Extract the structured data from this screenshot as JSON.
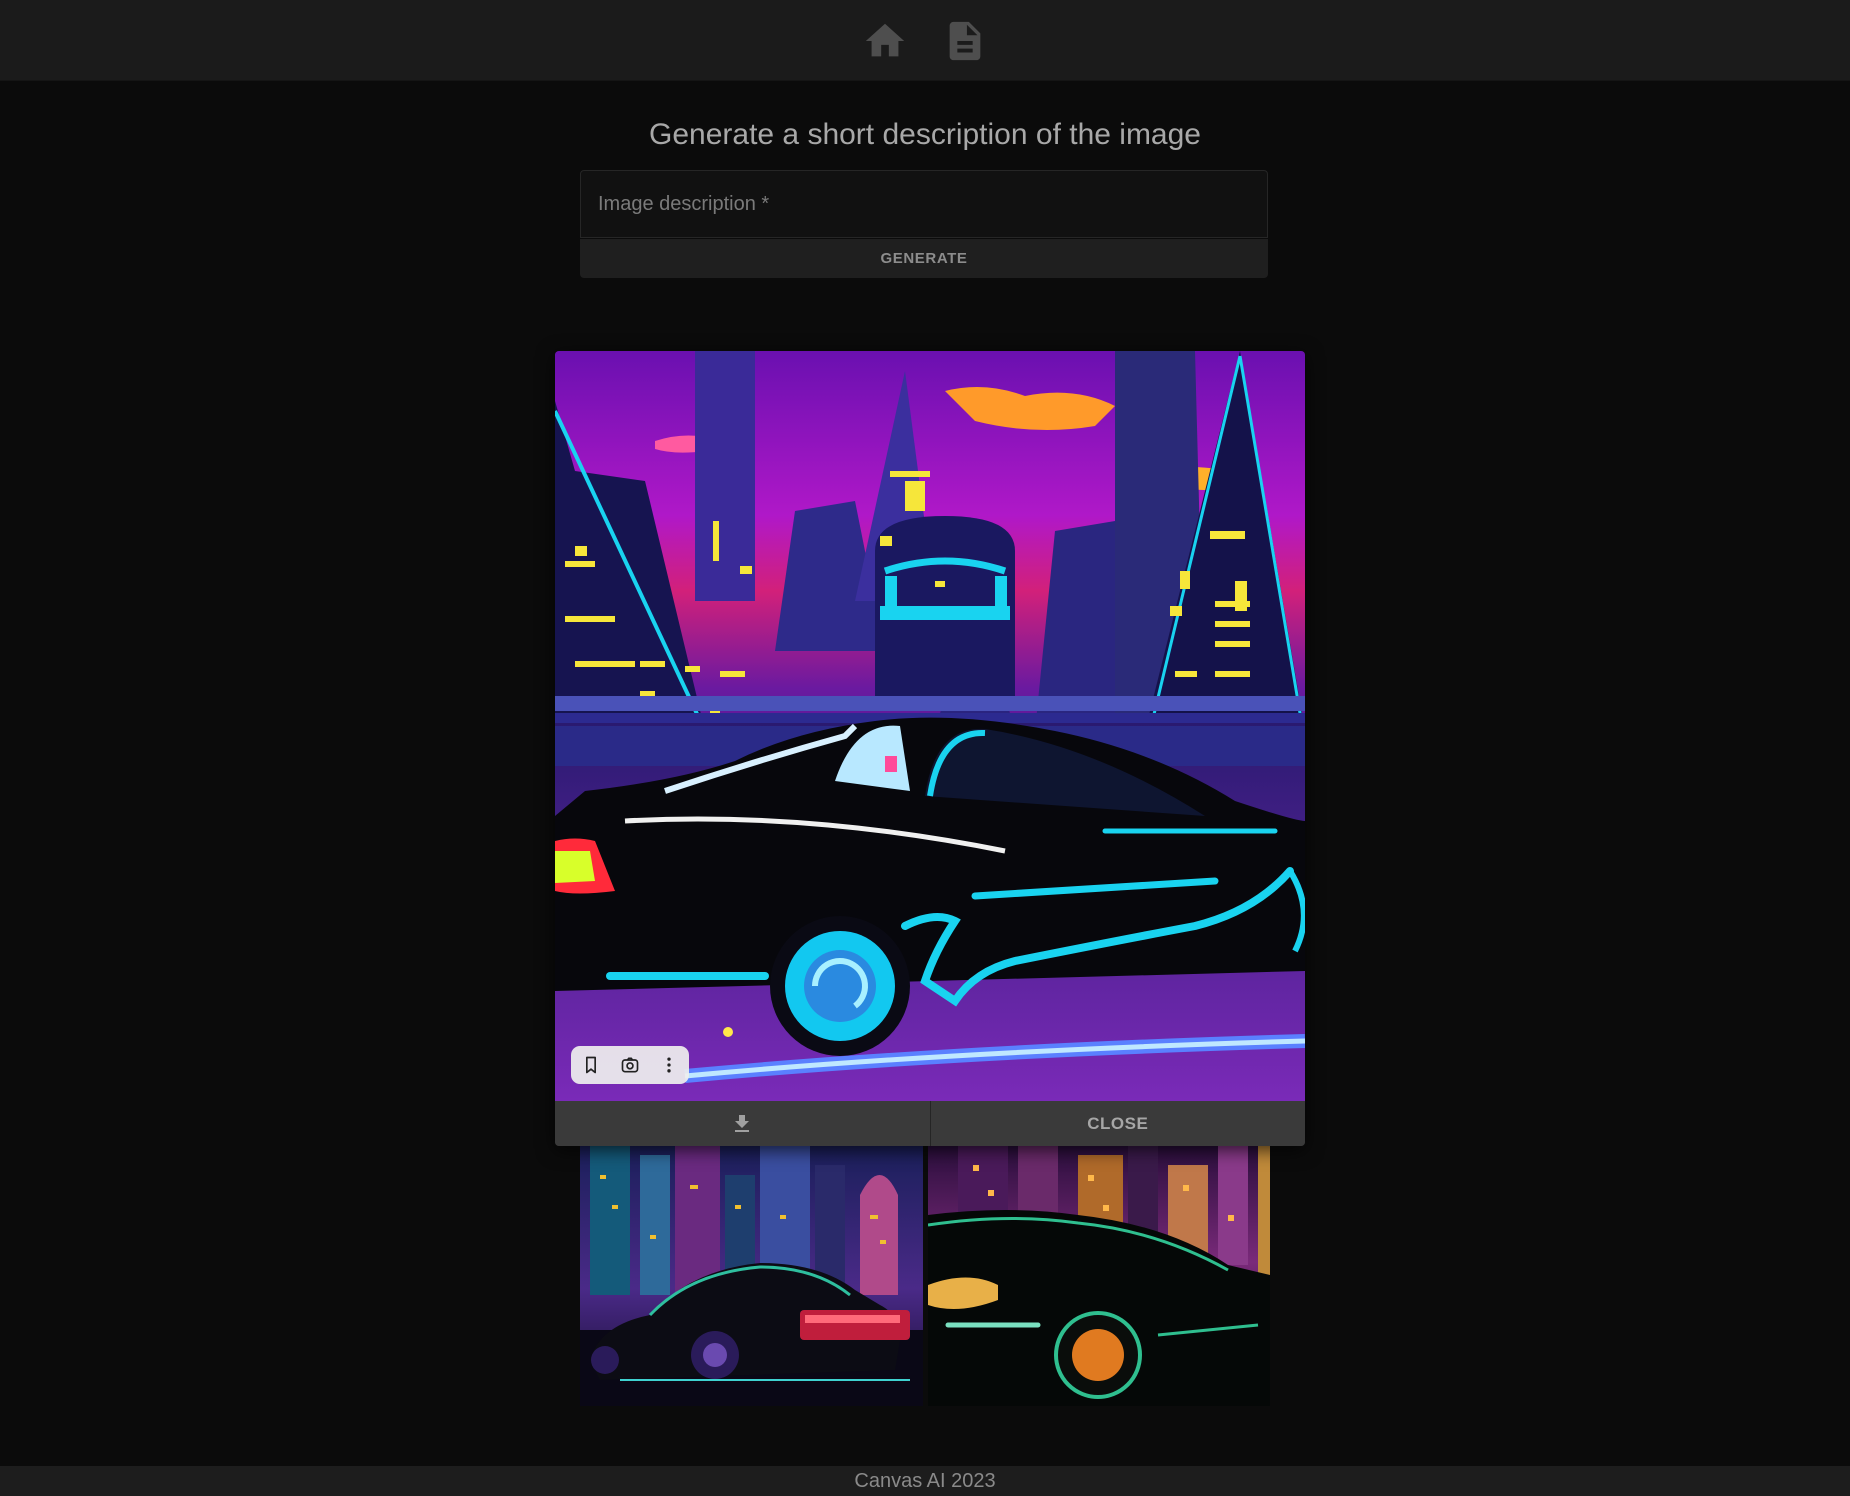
{
  "nav": {
    "home_icon": "home-icon",
    "docs_icon": "document-icon"
  },
  "form": {
    "title": "Generate a short description of the image",
    "description_placeholder": "Image description *",
    "description_value": "",
    "generate_label": "GENERATE"
  },
  "viewer": {
    "overlay_icons": [
      "bookmark-icon",
      "lens-icon",
      "more-vert-icon"
    ],
    "download_icon": "download-icon",
    "close_label": "CLOSE"
  },
  "footer": {
    "text": "Canvas AI 2023"
  },
  "colors": {
    "background": "#0b0b0b",
    "topbar": "#1b1b1b",
    "action_bar": "#3a3a3a",
    "neon_cyan": "#19d3f0",
    "sky_magenta": "#b018c8"
  }
}
